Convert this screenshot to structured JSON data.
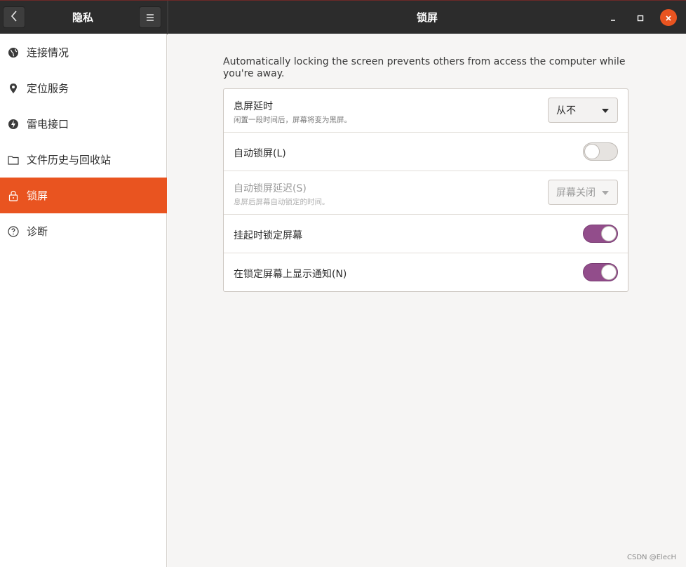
{
  "header": {
    "panel_title": "隐私",
    "window_title": "锁屏",
    "back_icon": "chevron-left-icon",
    "menu_icon": "hamburger-menu-icon"
  },
  "sidebar": {
    "items": [
      {
        "label": "连接情况",
        "icon": "globe-icon"
      },
      {
        "label": "定位服务",
        "icon": "map-pin-icon"
      },
      {
        "label": "雷电接口",
        "icon": "thunderbolt-icon"
      },
      {
        "label": "文件历史与回收站",
        "icon": "folder-icon"
      },
      {
        "label": "锁屏",
        "icon": "lock-icon",
        "active": true
      },
      {
        "label": "诊断",
        "icon": "help-circle-icon"
      }
    ]
  },
  "main": {
    "description": "Automatically locking the screen prevents others from access the computer while you're away.",
    "rows": [
      {
        "title": "息屏延时",
        "subtitle": "闲置一段时间后，屏幕将变为黑屏。",
        "control": "combo",
        "value": "从不",
        "enabled": true
      },
      {
        "title": "自动锁屏(L)",
        "control": "switch",
        "state": false
      },
      {
        "title": "自动锁屏延迟(S)",
        "subtitle": "息屏后屏幕自动锁定的时间。",
        "control": "combo",
        "value": "屏幕关闭",
        "enabled": false
      },
      {
        "title": "挂起时锁定屏幕",
        "control": "switch",
        "state": true
      },
      {
        "title": "在锁定屏幕上显示通知(N)",
        "control": "switch",
        "state": true
      }
    ]
  },
  "colors": {
    "accent": "#e95420",
    "switch_on": "#924d8b",
    "headerbar": "#2c2c2c"
  },
  "watermark": "CSDN @ElecH"
}
